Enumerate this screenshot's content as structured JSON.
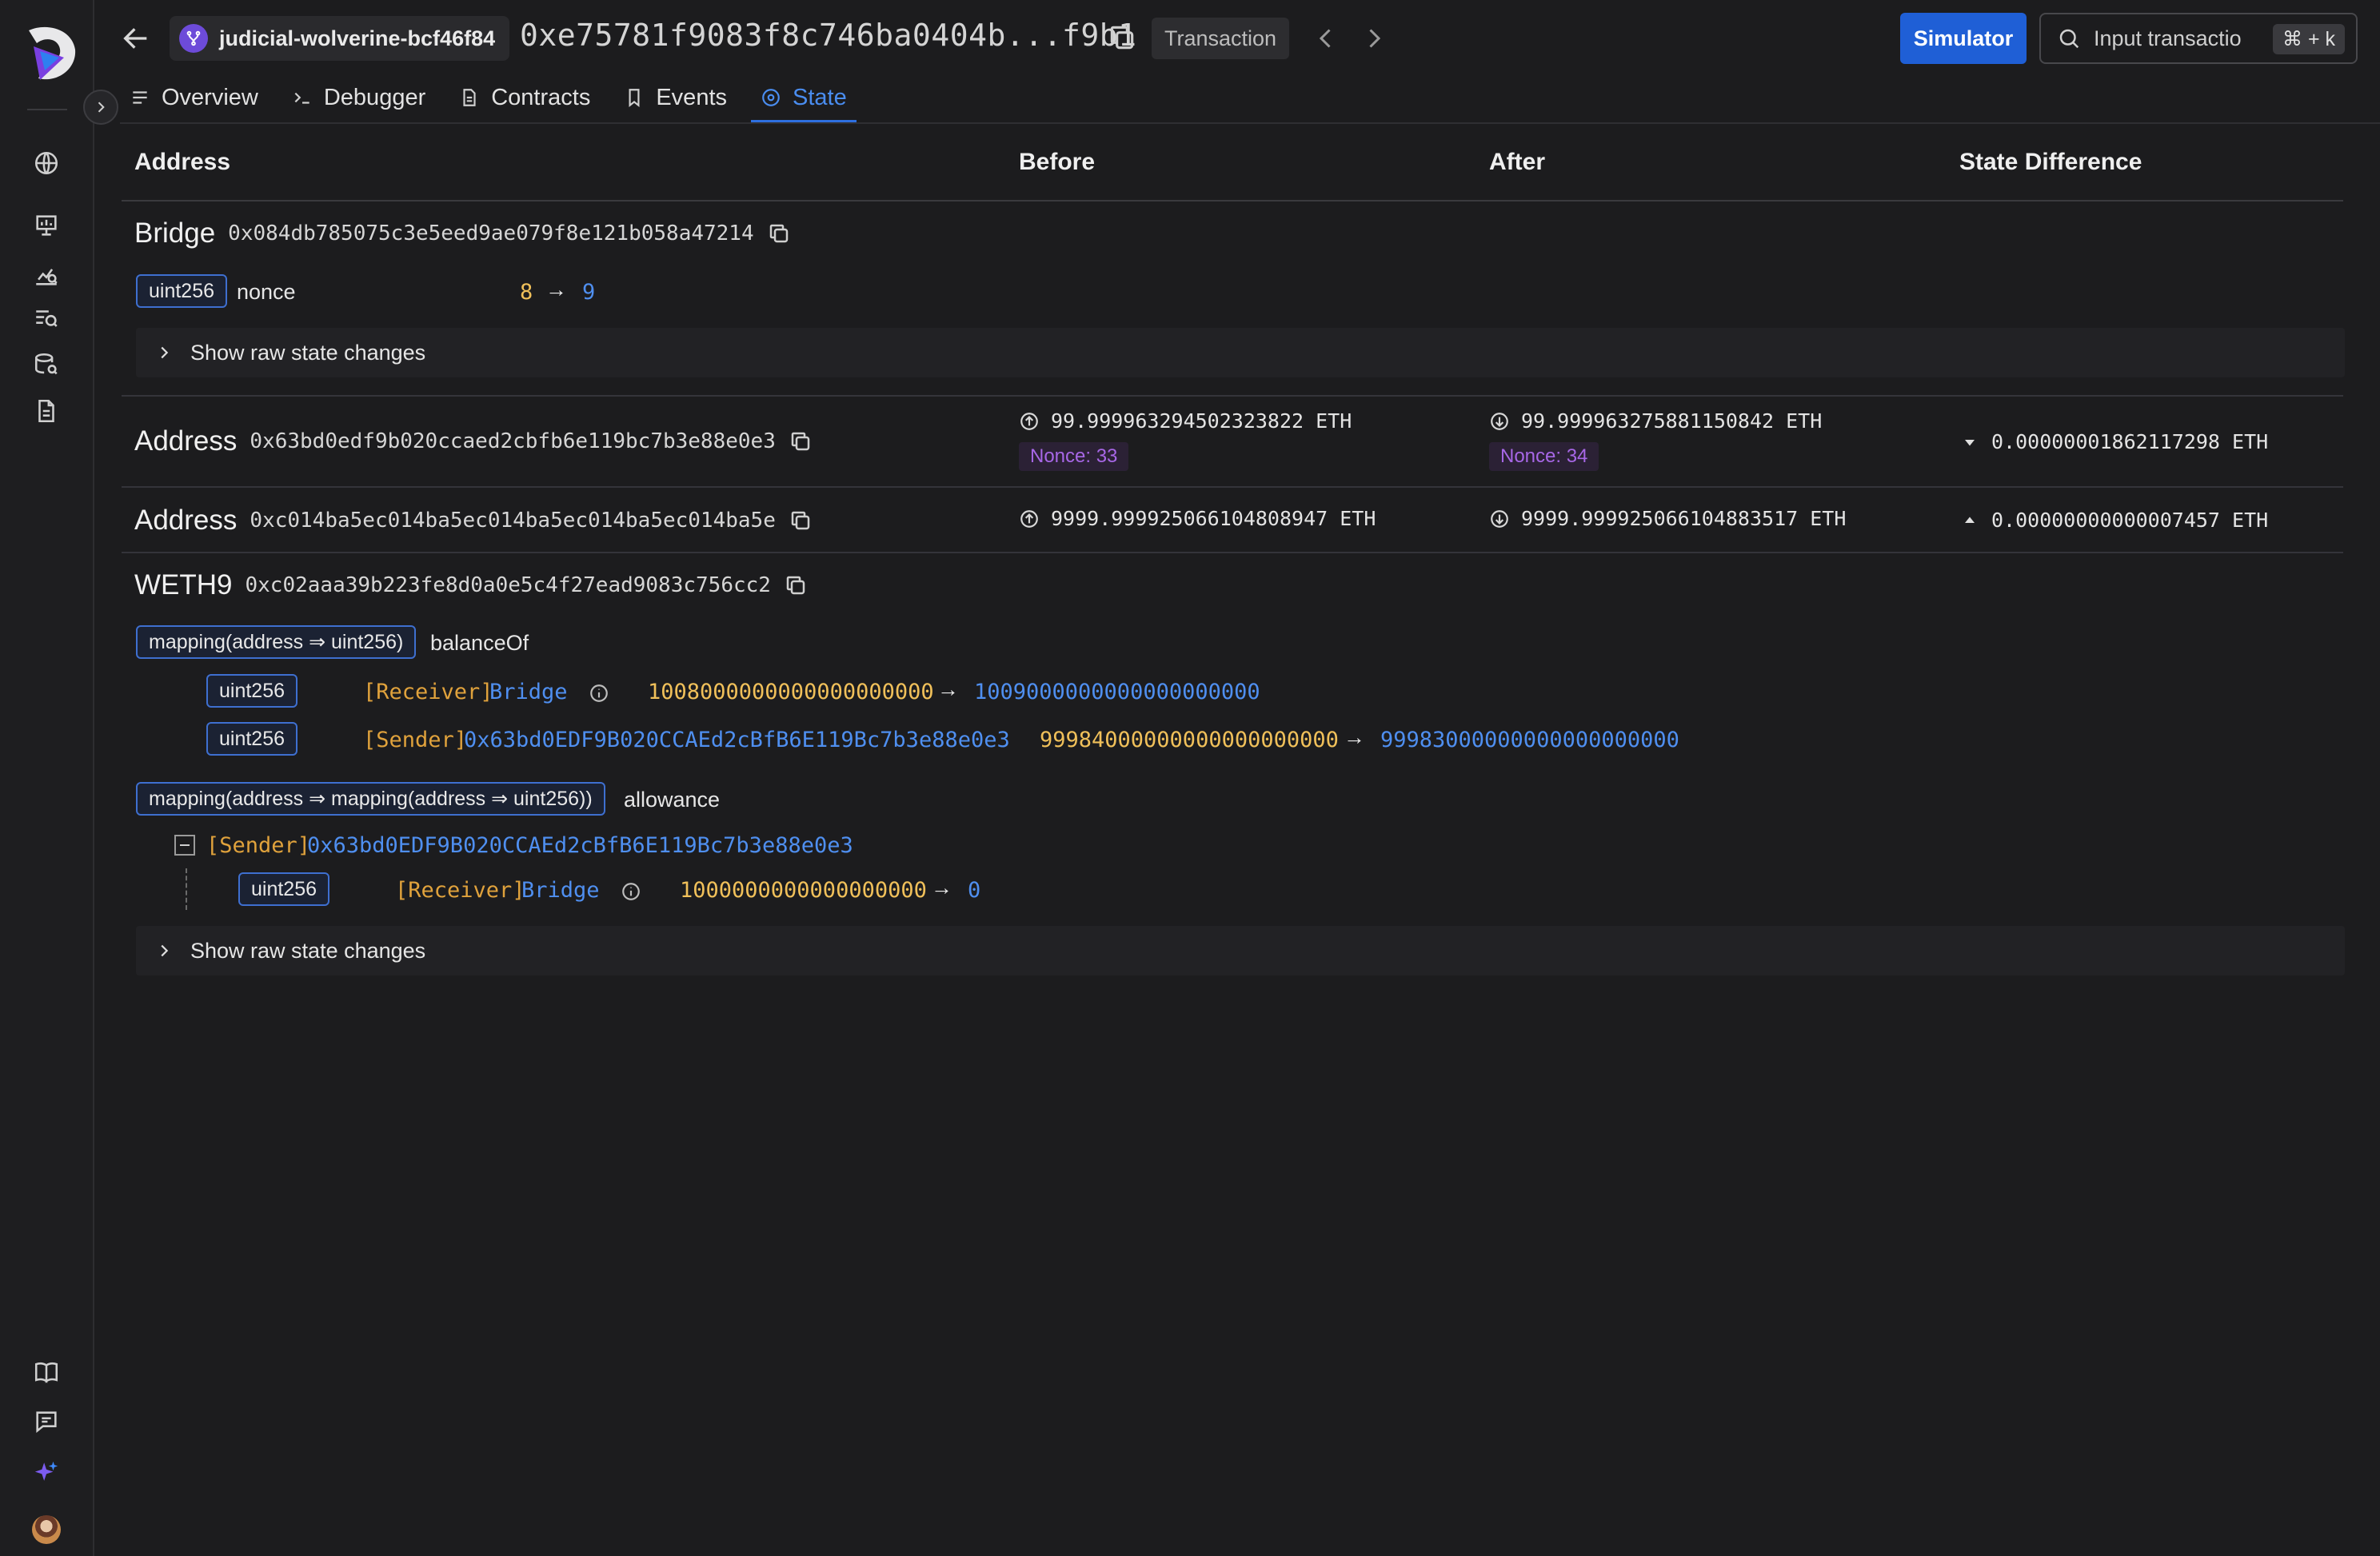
{
  "header": {
    "project": "judicial-wolverine-bcf46f84",
    "tx_hash": "0xe75781f9083f8c746ba0404b...f9b1",
    "tx_badge": "Transaction",
    "simulator_label": "Simulator",
    "search_placeholder": "Input transactio",
    "shortcut": "⌘ + k"
  },
  "tabs": [
    {
      "label": "Overview",
      "icon": "list-icon"
    },
    {
      "label": "Debugger",
      "icon": "terminal-icon"
    },
    {
      "label": "Contracts",
      "icon": "file-icon"
    },
    {
      "label": "Events",
      "icon": "bookmark-icon"
    },
    {
      "label": "State",
      "icon": "target-icon",
      "active": true
    }
  ],
  "table_headers": {
    "address": "Address",
    "before": "Before",
    "after": "After",
    "diff": "State Difference"
  },
  "bridge": {
    "name": "Bridge",
    "address": "0x084db785075c3e5eed9ae079f8e121b058a47214",
    "var_type": "uint256",
    "var_name": "nonce",
    "before": "8",
    "arrow": "→",
    "after": "9",
    "raw_label": "Show raw state changes"
  },
  "accounts": [
    {
      "label": "Address",
      "address": "0x63bd0edf9b020ccaed2cbfb6e119bc7b3e88e0e3",
      "before": "99.999963294502323822 ETH",
      "before_nonce": "Nonce: 33",
      "after": "99.999963275881150842 ETH",
      "after_nonce": "Nonce: 34",
      "diff": "0.00000001862117298 ETH",
      "diff_direction": "down"
    },
    {
      "label": "Address",
      "address": "0xc014ba5ec014ba5ec014ba5ec014ba5ec014ba5e",
      "before": "9999.999925066104808947 ETH",
      "after": "9999.999925066104883517 ETH",
      "diff": "0.00000000000007457 ETH",
      "diff_direction": "up"
    }
  ],
  "weth9": {
    "name": "WETH9",
    "address": "0xc02aaa39b223fe8d0a0e5c4f27ead9083c756cc2",
    "balance_mapping_type": "mapping(address ⇒ uint256)",
    "balance_name": "balanceOf",
    "balance_rows": [
      {
        "type": "uint256",
        "role": "[Receiver]",
        "who": "Bridge",
        "before": "1008000000000000000000",
        "arrow": "→",
        "after": "1009000000000000000000"
      },
      {
        "type": "uint256",
        "role": "[Sender]",
        "who": "0x63bd0EDF9B020CCAEd2cBfB6E119Bc7b3e88e0e3",
        "before": "99984000000000000000000",
        "arrow": "→",
        "after": "99983000000000000000000"
      }
    ],
    "allowance_mapping_type": "mapping(address ⇒ mapping(address ⇒ uint256))",
    "allowance_name": "allowance",
    "allowance_owner_role": "[Sender]",
    "allowance_owner": "0x63bd0EDF9B020CCAEd2cBfB6E119Bc7b3e88e0e3",
    "allowance_row": {
      "type": "uint256",
      "role": "[Receiver]",
      "who": "Bridge",
      "before": "1000000000000000000",
      "arrow": "→",
      "after": "0"
    },
    "raw_label": "Show raw state changes"
  },
  "colors": {
    "accent": "#2e6fe0",
    "before_value": "#f0c05a",
    "after_value": "#4f8ff0",
    "nonce": "#a767e6"
  }
}
